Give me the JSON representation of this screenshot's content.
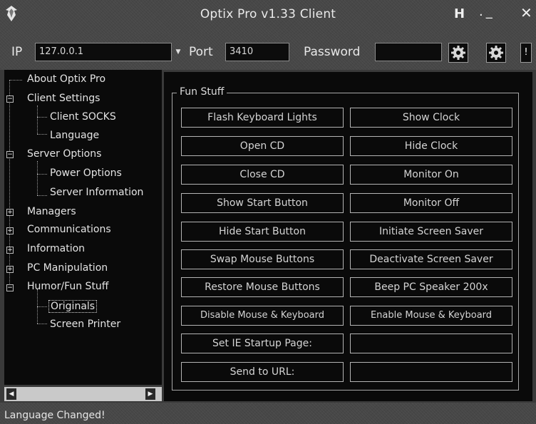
{
  "window": {
    "title": "Optix Pro v1.33 Client",
    "help_label": "H",
    "minimize_label": "._",
    "close_label": "✕"
  },
  "toolbar": {
    "ip_label": "IP",
    "ip_value": "127.0.0.1",
    "port_label": "Port",
    "port_value": "3410",
    "password_label": "Password",
    "password_value": "",
    "connect_icon": "gear-icon",
    "disconnect_icon": "gear-icon",
    "extra_label": "!"
  },
  "tree": {
    "items": [
      {
        "label": "About Optix Pro"
      },
      {
        "label": "Client Settings",
        "expander": "−"
      },
      {
        "label": "Client SOCKS"
      },
      {
        "label": "Language"
      },
      {
        "label": "Server Options",
        "expander": "−"
      },
      {
        "label": "Power Options"
      },
      {
        "label": "Server Information"
      },
      {
        "label": "Managers",
        "expander": "+"
      },
      {
        "label": "Communications",
        "expander": "+"
      },
      {
        "label": "Information",
        "expander": "+"
      },
      {
        "label": "PC Manipulation",
        "expander": "+"
      },
      {
        "label": "Humor/Fun Stuff",
        "expander": "−"
      },
      {
        "label": "Originals",
        "selected": true
      },
      {
        "label": "Screen Printer"
      }
    ]
  },
  "scrollbar": {
    "left_arrow": "◀",
    "right_arrow": "▶"
  },
  "fun_stuff": {
    "legend": "Fun Stuff",
    "left_buttons": [
      "Flash Keyboard Lights",
      "Open CD",
      "Close CD",
      "Show Start Button",
      "Hide Start Button",
      "Swap Mouse Buttons",
      "Restore Mouse Buttons",
      "Disable Mouse & Keyboard",
      "Set IE Startup Page:",
      "Send to URL:"
    ],
    "right_buttons": [
      "Show Clock",
      "Hide Clock",
      "Monitor On",
      "Monitor Off",
      "Initiate Screen Saver",
      "Deactivate Screen Saver",
      "Beep PC Speaker 200x",
      "Enable Mouse & Keyboard"
    ],
    "ie_startup_value": "",
    "send_url_value": ""
  },
  "status": {
    "text": "Language Changed!"
  },
  "colors": {
    "background": "#474747",
    "panel": "#0a0a0a",
    "border": "#b4b4b4",
    "text": "#e6e6e6"
  }
}
